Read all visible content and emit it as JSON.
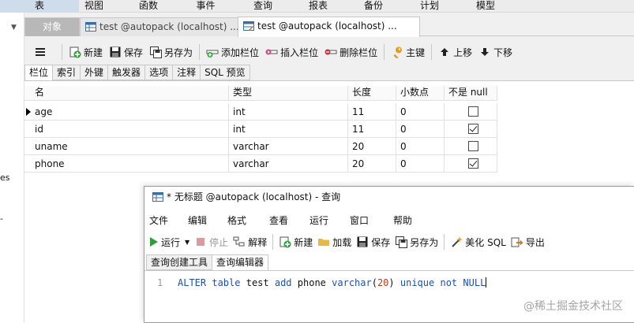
{
  "topmenu": [
    "表",
    "视图",
    "函数",
    "事件",
    "查询",
    "报表",
    "备份",
    "计划",
    "模型"
  ],
  "gutter": {
    "text1": "es",
    "text2": "-"
  },
  "tabs": {
    "objects": "对象",
    "tab1": "test @autopack (localhost) ...",
    "tab2": "test @autopack (localhost) ..."
  },
  "toolbar": {
    "new": "新建",
    "save": "保存",
    "save_as": "另存为",
    "add_field": "添加栏位",
    "insert_field": "插入栏位",
    "delete_field": "删除栏位",
    "primary_key": "主键",
    "move_up": "上移",
    "move_down": "下移"
  },
  "subtabs": [
    "栏位",
    "索引",
    "外键",
    "触发器",
    "选项",
    "注释",
    "SQL 预览"
  ],
  "grid": {
    "headers": [
      "名",
      "类型",
      "长度",
      "小数点",
      "不是 null"
    ],
    "rows": [
      {
        "name": "age",
        "type": "int",
        "length": "11",
        "decimals": "0",
        "not_null": false
      },
      {
        "name": "id",
        "type": "int",
        "length": "11",
        "decimals": "0",
        "not_null": true
      },
      {
        "name": "uname",
        "type": "varchar",
        "length": "20",
        "decimals": "0",
        "not_null": false
      },
      {
        "name": "phone",
        "type": "varchar",
        "length": "20",
        "decimals": "0",
        "not_null": true
      }
    ]
  },
  "query_window": {
    "title": "* 无标题 @autopack (localhost) - 查询",
    "menu": [
      "文件",
      "编辑",
      "格式",
      "查看",
      "运行",
      "窗口",
      "帮助"
    ],
    "toolbar": {
      "run": "运行",
      "stop": "停止",
      "explain": "解释",
      "new": "新建",
      "load": "加载",
      "save": "保存",
      "save_as": "另存为",
      "beautify": "美化 SQL",
      "export": "导出"
    },
    "subtabs": [
      "查询创建工具",
      "查询编辑器"
    ],
    "line_number": "1",
    "sql": {
      "t1": "ALTER",
      "t2": "table",
      "t3": "test",
      "t4": "add",
      "t5": "phone",
      "t6": "varchar",
      "t7": "(",
      "t8": "20",
      "t9": ")",
      "t10": "unique",
      "t11": "not",
      "t12": "NULL"
    }
  },
  "watermark": "@稀土掘金技术社区",
  "colors": {
    "keyword": "#1e4fb8",
    "number": "#b04020",
    "accent": "#cfdcec"
  }
}
